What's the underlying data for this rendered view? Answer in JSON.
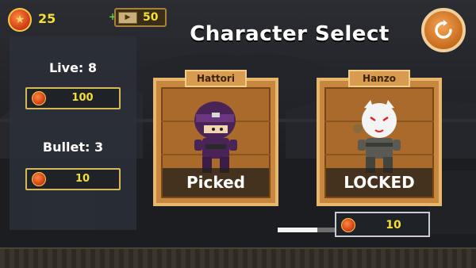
{
  "hud": {
    "coins": "25",
    "video_reward": "50",
    "coin_icon": "coin-icon",
    "video_icon": "video-icon",
    "plus_sign": "+"
  },
  "title": "Character Select",
  "restart_icon": "restart-icon",
  "upgrades": {
    "life_label": "Live: 8",
    "life_cost": "100",
    "bullet_label": "Bullet: 3",
    "bullet_cost": "10"
  },
  "characters": [
    {
      "name": "Hattori",
      "status": "Picked"
    },
    {
      "name": "Hanzo",
      "status": "LOCKED"
    }
  ],
  "unlock": {
    "cost": "10",
    "progress": 0.7
  },
  "colors": {
    "coin_text": "#f4df34",
    "panel": "#2c3038",
    "wood": "#c8873e",
    "wood_border": "#e9b66d",
    "accent": "#c86b1d"
  }
}
